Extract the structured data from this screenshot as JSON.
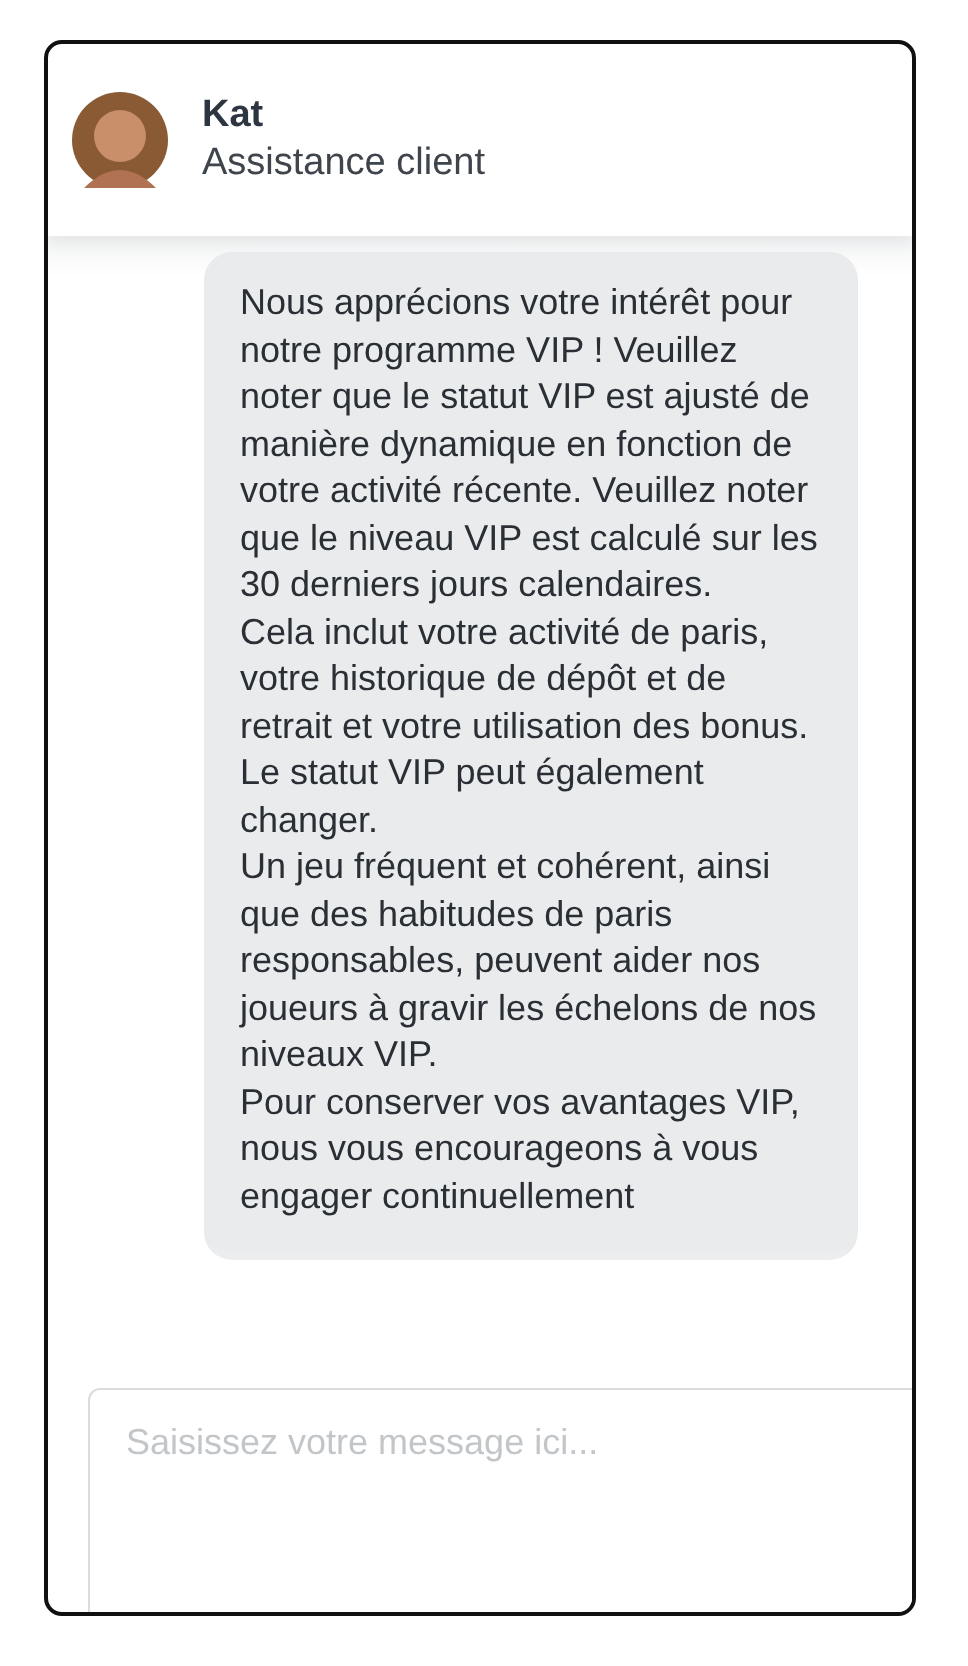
{
  "header": {
    "agent_name": "Kat",
    "agent_role": "Assistance client"
  },
  "messages": [
    {
      "paragraphs": [
        "Nous apprécions votre intérêt pour notre programme VIP ! Veuillez noter que le statut VIP est ajusté de manière dynamique en fonction de votre activité récente. Veuillez noter que le niveau VIP est calculé sur les 30 derniers jours calendaires.",
        "Cela inclut votre activité de paris, votre historique de dépôt et de retrait et votre utilisation des bonus. Le statut VIP peut également changer.",
        "Un jeu fréquent et cohérent, ainsi que des habitudes de paris responsables, peuvent aider nos joueurs à gravir les échelons de nos niveaux VIP.",
        "Pour conserver vos avantages VIP, nous vous encourageons à vous engager continuellement"
      ]
    }
  ],
  "composer": {
    "placeholder": "Saisissez votre message ici..."
  }
}
